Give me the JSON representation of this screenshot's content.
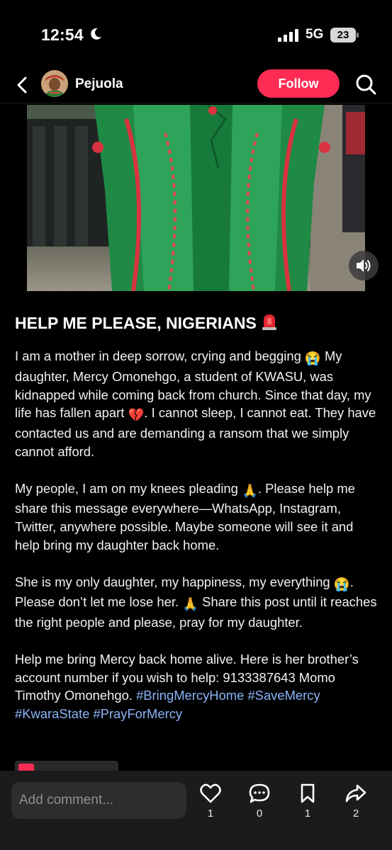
{
  "status_bar": {
    "time": "12:54",
    "network": "5G",
    "battery": "23"
  },
  "header": {
    "author": "Pejuola",
    "follow_label": "Follow"
  },
  "post": {
    "title": "HELP ME PLEASE, NIGERIANS",
    "paragraphs": [
      [
        "I am a mother in deep sorrow, crying and begging ",
        "😭",
        " My daughter, Mercy Omonehgo, a student of KWASU, was kidnapped while coming back from church. Since that day, my life has fallen apart ",
        "💔",
        ". I cannot sleep, I cannot eat. They have contacted us and are demanding a ransom that we simply cannot afford."
      ],
      [
        "My people, I am on my knees pleading ",
        "🙏",
        ". Please help me share this message everywhere—WhatsApp, Instagram, Twitter, anywhere possible. Maybe someone will see it and help bring my daughter back home."
      ],
      [
        "She is my only daughter, my happiness, my everything ",
        "😭",
        ". Please don’t let me lose her. ",
        "🙏",
        " Share this post until it reaches the right people and please, pray for my daughter."
      ],
      [
        "Help me bring Mercy back home alive. Here is her brother’s account number if you wish to help: 9133387643 Momo Timothy Omonehgo."
      ]
    ],
    "hashtags": "#BringMercyHome #SaveMercy #KwaraState #PrayForMercy"
  },
  "bottom_bar": {
    "comment_placeholder": "Add comment...",
    "likes": "1",
    "comments": "0",
    "saves": "1",
    "shares": "2"
  },
  "colors": {
    "accent": "#fe2c55",
    "hashtag": "#8ab4f8",
    "background": "#000000"
  },
  "icons": [
    "moon-icon",
    "signal-icon",
    "battery-icon",
    "back-arrow-icon",
    "search-icon",
    "volume-icon",
    "siren-icon",
    "heart-icon",
    "comment-icon",
    "bookmark-icon",
    "share-icon"
  ]
}
